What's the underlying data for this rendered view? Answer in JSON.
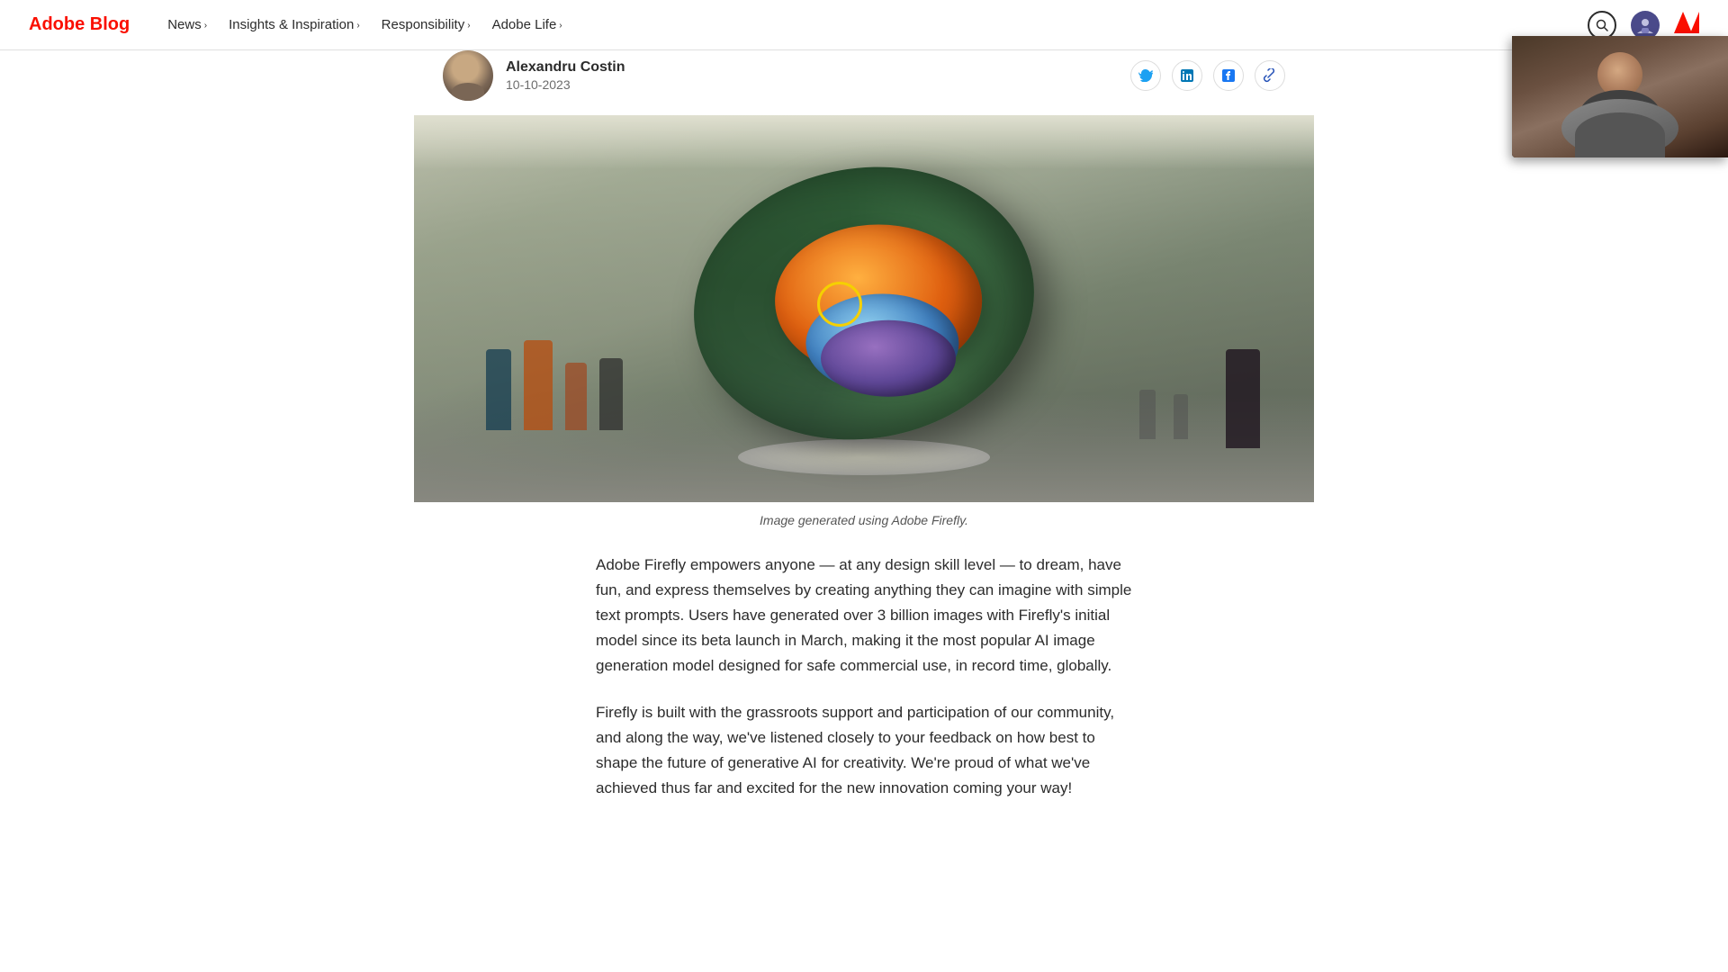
{
  "brand": {
    "name": "Adobe Blog",
    "logo_text": "Adobe"
  },
  "nav": {
    "items": [
      {
        "id": "news",
        "label": "News",
        "has_dropdown": true
      },
      {
        "id": "insights",
        "label": "Insights & Inspiration",
        "has_dropdown": true
      },
      {
        "id": "responsibility",
        "label": "Responsibility",
        "has_dropdown": true
      },
      {
        "id": "adobe-life",
        "label": "Adobe Life",
        "has_dropdown": true
      }
    ]
  },
  "author": {
    "name": "Alexandru Costin",
    "date": "10-10-2023"
  },
  "social": {
    "twitter_label": "Share on Twitter",
    "linkedin_label": "Share on LinkedIn",
    "facebook_label": "Share on Facebook",
    "copy_link_label": "Copy link"
  },
  "article": {
    "image_caption": "Image generated using Adobe Firefly.",
    "body_paragraph_1": "Adobe Firefly empowers anyone — at any design skill level — to dream, have fun, and express themselves by creating anything they can imagine with simple text prompts. Users have generated over 3 billion images with Firefly's initial model since its beta launch in March, making it the most popular AI image generation model designed for safe commercial use, in record time, globally.",
    "body_paragraph_2": "Firefly is built with the grassroots support and participation of our community, and along the way, we've listened closely to your feedback on how best to shape the future of generative AI for creativity. We're proud of what we've achieved thus far and excited for the new innovation coming your way!"
  }
}
